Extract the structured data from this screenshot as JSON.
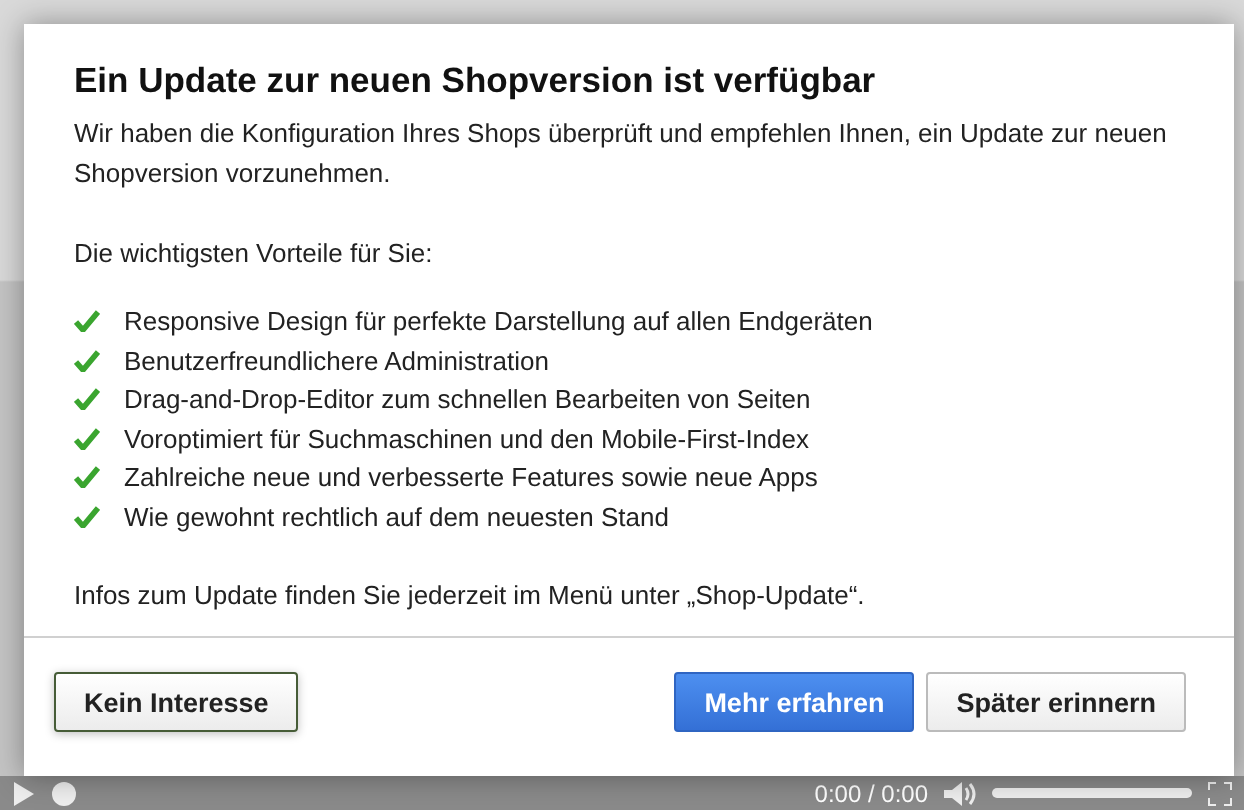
{
  "dialog": {
    "title": "Ein Update zur neuen Shopversion ist verfügbar",
    "intro": "Wir haben die Konfiguration Ihres Shops überprüft und empfehlen Ihnen, ein Update zur neuen Shopversion vorzunehmen.",
    "benefits_heading": "Die wichtigsten Vorteile für Sie:",
    "benefits": [
      "Responsive Design für perfekte Darstellung auf allen Endgeräten",
      "Benutzerfreundlichere Administration",
      "Drag-and-Drop-Editor zum schnellen Bearbeiten von Seiten",
      "Voroptimiert für Suchmaschinen und den Mobile-First-Index",
      "Zahlreiche neue und verbesserte Features sowie neue Apps",
      "Wie gewohnt rechtlich auf dem neuesten Stand"
    ],
    "note": "Infos zum Update finden Sie jederzeit im Menü unter „Shop-Update“.",
    "buttons": [
      {
        "label": "Kein Interesse",
        "kind": "outline"
      },
      {
        "label": "Mehr erfahren",
        "kind": "primary"
      },
      {
        "label": "Später erinnern",
        "kind": "default"
      }
    ]
  },
  "player": {
    "time": "0:00 / 0:00"
  }
}
